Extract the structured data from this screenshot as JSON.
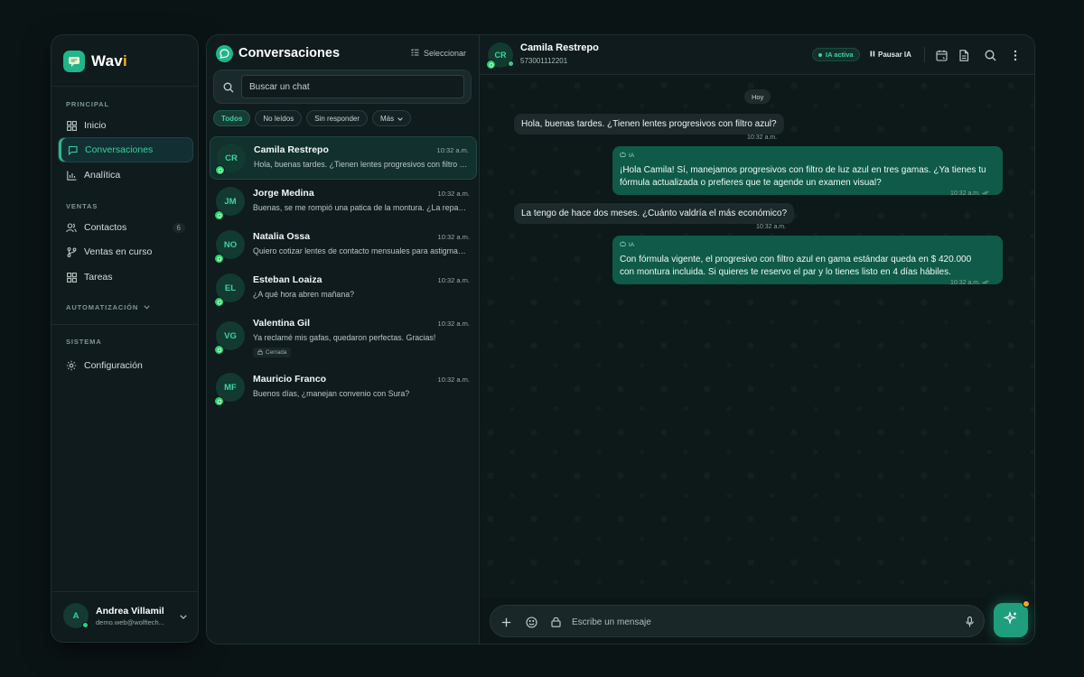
{
  "brand": {
    "name_main": "Wav",
    "name_accent": "i"
  },
  "sidebar": {
    "sections": {
      "principal": "PRINCIPAL",
      "ventas": "VENTAS",
      "automatizacion": "AUTOMATIZACIÓN",
      "sistema": "SISTEMA"
    },
    "items": [
      {
        "label": "Inicio",
        "icon": "grid-icon"
      },
      {
        "label": "Conversaciones",
        "icon": "chat-icon",
        "active": true
      },
      {
        "label": "Analítica",
        "icon": "chart-icon"
      },
      {
        "label": "Contactos",
        "icon": "users-icon",
        "count": "6"
      },
      {
        "label": "Ventas en curso",
        "icon": "branch-icon"
      },
      {
        "label": "Tareas",
        "icon": "grid-icon"
      },
      {
        "label": "Configuración",
        "icon": "gear-icon"
      }
    ],
    "user": {
      "initial": "A",
      "name": "Andrea Villamil",
      "email": "demo.web@wolftech..."
    }
  },
  "conversations": {
    "title": "Conversaciones",
    "select_label": "Seleccionar",
    "search_placeholder": "Buscar un chat",
    "filters": [
      "Todos",
      "No leídos",
      "Sin responder",
      "Más"
    ],
    "items": [
      {
        "initials": "CR",
        "name": "Camila Restrepo",
        "time": "10:32 a.m.",
        "preview": "Hola, buenas tardes. ¿Tienen lentes progresivos con filtro azul?",
        "active": true
      },
      {
        "initials": "JM",
        "name": "Jorge Medina",
        "time": "10:32 a.m.",
        "preview": "Buenas, se me rompió una patica de la montura. ¿La reparan?"
      },
      {
        "initials": "NO",
        "name": "Natalia Ossa",
        "time": "10:32 a.m.",
        "preview": "Quiero cotizar lentes de contacto mensuales para astigmatismo"
      },
      {
        "initials": "EL",
        "name": "Esteban Loaiza",
        "time": "10:32 a.m.",
        "preview": "¿A qué hora abren mañana?"
      },
      {
        "initials": "VG",
        "name": "Valentina Gil",
        "time": "10:32 a.m.",
        "preview": "Ya reclamé mis gafas, quedaron perfectas. Gracias!",
        "tag": "Cerrada"
      },
      {
        "initials": "MF",
        "name": "Mauricio Franco",
        "time": "10:32 a.m.",
        "preview": "Buenos días, ¿manejan convenio con Sura?"
      }
    ]
  },
  "chat": {
    "contact": {
      "initials": "CR",
      "name": "Camila Restrepo",
      "phone": "573001112201"
    },
    "ia_status": "IA activa",
    "pause_label": "Pausar IA",
    "day_label": "Hoy",
    "messages": [
      {
        "dir": "in",
        "text": "Hola, buenas tardes. ¿Tienen lentes progresivos con filtro azul?",
        "time": "10:32 a.m."
      },
      {
        "dir": "out",
        "ia": "IA",
        "lines": [
          "¡Hola Camila! Sí, manejamos progresivos con filtro de luz azul en tres gamas. ¿Ya tienes tu",
          "fórmula actualizada o prefieres que te agende un examen visual?"
        ],
        "time": "10:32 a.m."
      },
      {
        "dir": "in",
        "text": "La tengo de hace dos meses. ¿Cuánto valdría el más económico?",
        "time": "10:32 a.m."
      },
      {
        "dir": "out",
        "ia": "IA",
        "lines": [
          "Con fórmula vigente, el progresivo con filtro azul en gama estándar queda en $ 420.000",
          "con montura incluida. Si quieres te reservo el par y lo tienes listo en 4 días hábiles."
        ],
        "time": "10:32 a.m."
      }
    ],
    "composer_placeholder": "Escribe un mensaje"
  },
  "colors": {
    "accent": "#34d39c",
    "outgoing_bubble": "#0f5a48",
    "badge_dot": "#f5a524"
  }
}
